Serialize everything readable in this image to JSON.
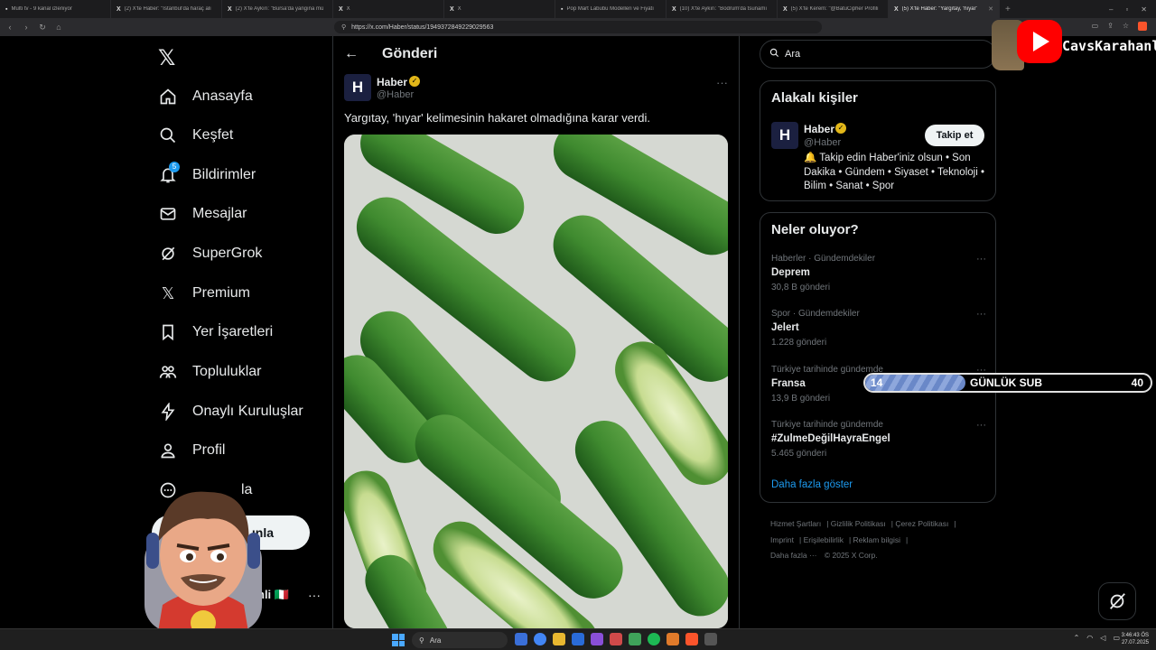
{
  "browser": {
    "tabs": [
      {
        "title": "Multi tv - 9 kanal izleniyor",
        "active": false
      },
      {
        "title": "(2) X'te Haber: \"İstanbul'da haraç alı",
        "active": false
      },
      {
        "title": "(2) X'te Aykırı: \"Bursa'da yangına mü",
        "active": false
      },
      {
        "title": "X",
        "active": false
      },
      {
        "title": "X",
        "active": false
      },
      {
        "title": "Pop Mart Labubu Modelleri ve Fiyatı",
        "active": false
      },
      {
        "title": "(10) X'te Aykırı: \"Bodrum'da tsunamı",
        "active": false
      },
      {
        "title": "(5) X'te Kerem: \"@BatuCipher Profili",
        "active": false
      },
      {
        "title": "(5) X'te Haber: \"Yargıtay, 'hıyar' ",
        "active": true
      }
    ],
    "url": "https://x.com/Haber/status/1949372849229029563"
  },
  "sidebar": {
    "items": [
      {
        "label": "Anasayfa",
        "icon": "home-icon"
      },
      {
        "label": "Keşfet",
        "icon": "search-icon"
      },
      {
        "label": "Bildirimler",
        "icon": "bell-icon",
        "badge": "5"
      },
      {
        "label": "Mesajlar",
        "icon": "mail-icon"
      },
      {
        "label": "SuperGrok",
        "icon": "grok-icon"
      },
      {
        "label": "Premium",
        "icon": "x-icon"
      },
      {
        "label": "Yer İşaretleri",
        "icon": "bookmark-icon"
      },
      {
        "label": "Topluluklar",
        "icon": "communities-icon"
      },
      {
        "label": "Onaylı Kuruluşlar",
        "icon": "lightning-icon"
      },
      {
        "label": "Profil",
        "icon": "profile-icon"
      },
      {
        "label": "la",
        "icon": "more-icon"
      }
    ],
    "post_button": "ınla",
    "profile_name": "nli 🇮🇹"
  },
  "header": {
    "title": "Gönderi"
  },
  "post": {
    "author_name": "Haber",
    "author_handle": "@Haber",
    "text": "Yargıtay, 'hıyar' kelimesinin hakaret olmadığına karar verdi."
  },
  "search": {
    "placeholder": "Ara"
  },
  "related": {
    "title": "Alakalı kişiler",
    "name": "Haber",
    "handle": "@Haber",
    "follow_label": "Takip et",
    "bio": "🔔 Takip edin Haber'iniz olsun • Son Dakika • Gündem • Siyaset • Teknoloji • Bilim • Sanat • Spor"
  },
  "trends": {
    "title": "Neler oluyor?",
    "items": [
      {
        "meta": "Haberler · Gündemdekiler",
        "name": "Deprem",
        "count": "30,8 B gönderi"
      },
      {
        "meta": "Spor · Gündemdekiler",
        "name": "Jelert",
        "count": "1.228 gönderi"
      },
      {
        "meta": "Türkiye tarihinde gündemde",
        "name": "Fransa",
        "count": "13,9 B gönderi"
      },
      {
        "meta": "Türkiye tarihinde gündemde",
        "name": "#ZulmeDeğilHayraEngel",
        "count": "5.465 gönderi"
      }
    ],
    "show_more": "Daha fazla göster"
  },
  "footer": {
    "links": [
      "Hizmet Şartları",
      "Gizlilik Politikası",
      "Çerez Politikası",
      "Imprint",
      "Erişilebilirlik",
      "Reklam bilgisi",
      "Daha fazla ···",
      "© 2025 X Corp."
    ]
  },
  "overlay": {
    "streamer_name": "CavsKarahanli",
    "sub_current": "14",
    "sub_label": "GÜNLÜK SUB",
    "sub_goal": "40",
    "sub_progress": 0.35
  },
  "taskbar": {
    "search_placeholder": "Ara",
    "time": "3:46:43 ÖS",
    "date": "27.07.2025"
  },
  "colors": {
    "accent": "#1d9bf0",
    "verified": "#e2b719",
    "background": "#000000"
  }
}
